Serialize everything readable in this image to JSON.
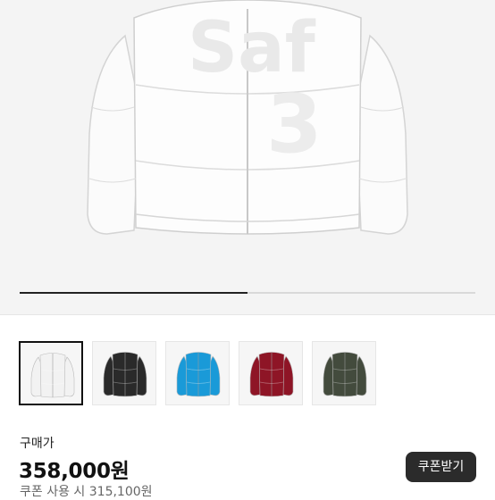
{
  "hero": {
    "image": "white-puffer-jacket-photo",
    "logo_text": "Saf",
    "logo_num": "3",
    "carousel_progress": 0.5
  },
  "thumbnails": [
    {
      "name": "white",
      "color": "#f2f2f2",
      "selected": true
    },
    {
      "name": "black",
      "color": "#2a2a2a",
      "selected": false
    },
    {
      "name": "sky-blue",
      "color": "#1a9ad8",
      "selected": false
    },
    {
      "name": "burgundy",
      "color": "#8e1526",
      "selected": false
    },
    {
      "name": "olive",
      "color": "#434b3d",
      "selected": false
    }
  ],
  "purchase": {
    "label": "구매가",
    "price": "358,000원",
    "coupon_price_text": "쿠폰 사용 시 315,100원",
    "coupon_button": "쿠폰받기"
  }
}
